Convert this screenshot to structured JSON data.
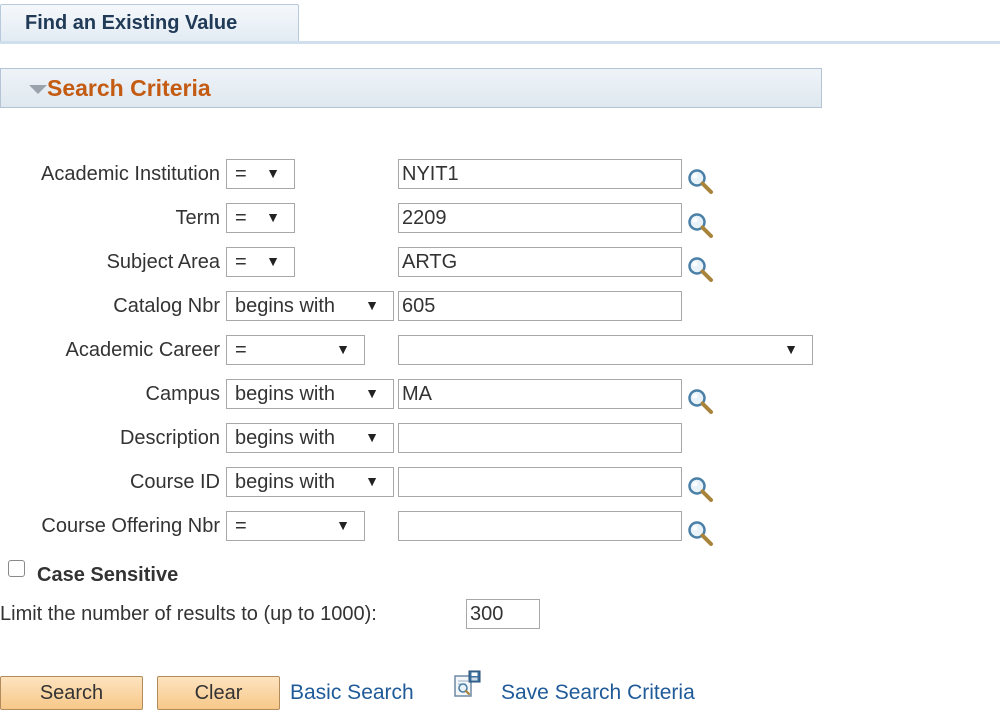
{
  "tab": {
    "label": "Find an Existing Value"
  },
  "section": {
    "title": "Search Criteria"
  },
  "fields": [
    {
      "label": "Academic Institution",
      "operator": "=",
      "value": "NYIT1"
    },
    {
      "label": "Term",
      "operator": "=",
      "value": "2209"
    },
    {
      "label": "Subject Area",
      "operator": "=",
      "value": "ARTG"
    },
    {
      "label": "Catalog Nbr",
      "operator": "begins with",
      "value": "605"
    },
    {
      "label": "Academic Career",
      "operator": "=",
      "value": ""
    },
    {
      "label": "Campus",
      "operator": "begins with",
      "value": "MA"
    },
    {
      "label": "Description",
      "operator": "begins with",
      "value": ""
    },
    {
      "label": "Course ID",
      "operator": "begins with",
      "value": ""
    },
    {
      "label": "Course Offering Nbr",
      "operator": "=",
      "value": ""
    }
  ],
  "case_sensitive": {
    "label": "Case Sensitive",
    "checked": false
  },
  "limit": {
    "label": "Limit the number of results to (up to 1000):",
    "value": "300"
  },
  "buttons": {
    "search": "Search",
    "clear": "Clear"
  },
  "links": {
    "basic_search": "Basic Search",
    "save_search": "Save Search Criteria"
  },
  "icons": {
    "lookup": "magnifier-lookup-icon",
    "save_search": "save-search-icon",
    "collapse": "collapse-triangle-icon"
  },
  "colors": {
    "section_title": "#c45b12",
    "link": "#1f5a99",
    "tab_text": "#203a57",
    "button": "#f7c889"
  }
}
